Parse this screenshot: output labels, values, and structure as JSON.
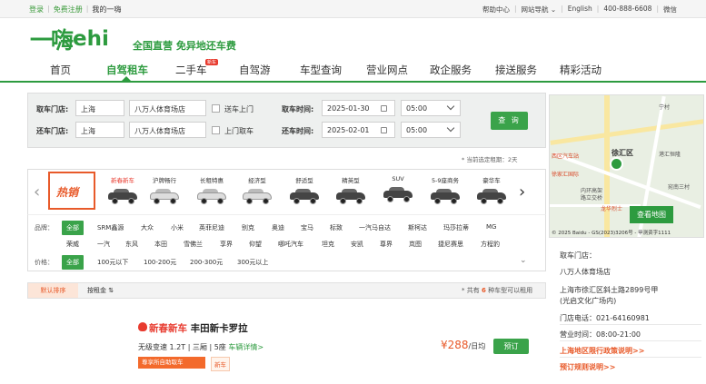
{
  "topbar": {
    "login": "登录",
    "register": "免费注册",
    "my": "我的一嗨",
    "help": "帮助中心",
    "sitenav": "网站导航",
    "lang": "English",
    "phone": "400-888-6608",
    "wechat": "微信"
  },
  "brand": {
    "logo_cn": "一嗨",
    "logo_en": "ehi",
    "slogan": "全国直营  免异地还车费"
  },
  "nav": {
    "items": [
      "首页",
      "自驾租车",
      "二手车",
      "自驾游",
      "车型查询",
      "营业网点",
      "政企服务",
      "接送服务",
      "精彩活动"
    ],
    "badge": "新车",
    "active": "自驾租车"
  },
  "search": {
    "pickup_label": "取车门店:",
    "pickup_city": "上海",
    "pickup_store": "八万人体育场店",
    "delivery_label": "送车上门",
    "pickup_time_label": "取车时间:",
    "pickup_date": "2025-01-30",
    "pickup_hour": "05:00",
    "return_label": "还车门店:",
    "return_city": "上海",
    "return_store": "八万人体育场店",
    "collect_label": "上门取车",
    "return_time_label": "还车时间:",
    "return_date": "2025-02-01",
    "return_hour": "05:00",
    "search_button": "查 询",
    "tip": "* 当前选定租期：2天"
  },
  "categories": {
    "hot_label": "热销",
    "items": [
      "新春新车",
      "沪牌畅行",
      "长租特惠",
      "经济型",
      "舒适型",
      "精英型",
      "SUV",
      "5-9座商务",
      "豪华车"
    ]
  },
  "filters": {
    "brand_label": "品牌：",
    "brand_row1": [
      "全部",
      "SRM鑫源",
      "大众",
      "小米",
      "英菲尼迪",
      "别克",
      "奥迪",
      "宝马",
      "标致",
      "一汽马自达",
      "斯柯达",
      "玛莎拉蒂",
      "MG"
    ],
    "brand_row2": [
      "荣威",
      "一汽",
      "东风",
      "本田",
      "雪佛兰",
      "享界",
      "仰望",
      "哪吒汽车",
      "坦克",
      "安凯",
      "尊界",
      "岚图",
      "捷尼赛思",
      "方程豹"
    ],
    "price_label": "价格：",
    "prices": [
      "全部",
      "100元以下",
      "100-200元",
      "200-300元",
      "300元以上"
    ]
  },
  "sort": {
    "default": "默认排序",
    "by_price": "按租金",
    "count_prefix": "* 共有",
    "count_num": "6",
    "count_suffix": "种车型可以租用"
  },
  "listing": {
    "badge": "新春新车",
    "name": "丰田新卡罗拉",
    "specs": "无级变速 1.2T | 三厢 | 5座",
    "detail": "车辆详情>",
    "tag1": "尊享所自助取车",
    "tag2": "新车",
    "price": "¥288",
    "price_unit": "/日均",
    "book": "预订"
  },
  "map": {
    "district": "徐汇区",
    "label1": "西区汽车站",
    "label2": "港汇恒隆",
    "label3": "徐家汇国际",
    "label4": "内环高架",
    "label5": "路立交桥",
    "label6": "宛南三村",
    "label7": "龙华烈士",
    "label8": "宁村",
    "view_button": "查看地图",
    "copyright": "© 2025 Baidu - GS(2023)3206号 - 甲测资字1111"
  },
  "store": {
    "title": "取车门店：",
    "name": "八万人体育场店",
    "address": "上海市徐汇区斜土路2899号甲",
    "address2": "(光启文化广场内)",
    "phone": "门店电话：021-64160981",
    "hours": "营业时间：08:00-21:00",
    "policy": "上海地区限行政策说明>>",
    "rules": "预订规则说明>>"
  }
}
